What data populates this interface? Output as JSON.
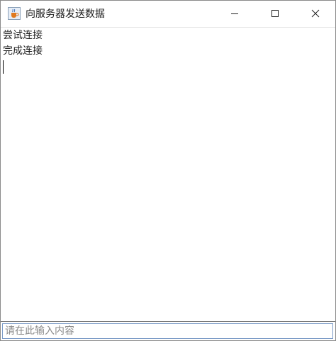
{
  "window": {
    "title": "向服务器发送数据",
    "app_icon": "java-cup-icon",
    "controls": [
      "minimize-icon",
      "maximize-icon",
      "close-icon"
    ]
  },
  "output": {
    "lines": [
      "尝试连接",
      "完成连接"
    ]
  },
  "input": {
    "value": "",
    "placeholder": "请在此输入内容"
  }
}
